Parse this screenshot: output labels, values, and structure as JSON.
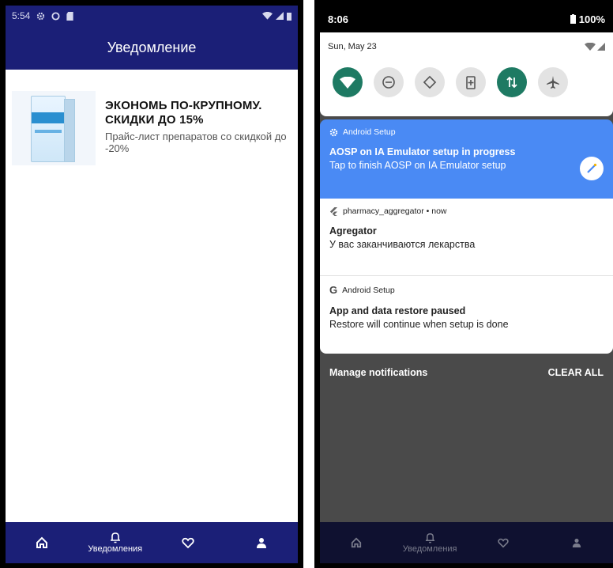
{
  "left": {
    "status": {
      "time": "5:54"
    },
    "appbar": {
      "title": "Уведомление"
    },
    "notification": {
      "title_line1": "ЭКОНОМЬ ПО-КРУПНОМУ.",
      "title_line2": "СКИДКИ ДО 15%",
      "subtitle": "Прайс-лист препаратов со скидкой до -20%",
      "image": "medicine-box-image"
    },
    "nav": {
      "items": [
        {
          "icon": "home-icon",
          "label": ""
        },
        {
          "icon": "bell-icon",
          "label": "Уведомления"
        },
        {
          "icon": "heart-icon",
          "label": ""
        },
        {
          "icon": "person-icon",
          "label": ""
        }
      ]
    }
  },
  "right": {
    "status": {
      "time": "8:06",
      "battery": "100%"
    },
    "quick_settings": {
      "date": "Sun, May 23",
      "tiles": [
        {
          "icon": "wifi-icon",
          "state": "on"
        },
        {
          "icon": "do-not-disturb-icon",
          "state": "off"
        },
        {
          "icon": "auto-rotate-icon",
          "state": "off"
        },
        {
          "icon": "battery-saver-icon",
          "state": "off"
        },
        {
          "icon": "mobile-data-icon",
          "state": "on"
        },
        {
          "icon": "airplane-icon",
          "state": "off"
        }
      ]
    },
    "notifications": [
      {
        "app": "Android Setup",
        "title": "AOSP on IA Emulator setup in progress",
        "text": "Tap to finish AOSP on IA Emulator setup"
      },
      {
        "app": "pharmacy_aggregator • now",
        "title": "Agregator",
        "text": "У вас заканчиваются лекарства"
      },
      {
        "app": "Android Setup",
        "title": "App and data restore paused",
        "text": "Restore will continue when setup is done"
      }
    ],
    "manage_label": "Manage notifications",
    "clear_all_label": "CLEAR ALL",
    "nav": {
      "label": "Уведомления"
    }
  },
  "colors": {
    "brand": "#1b1f77",
    "notification_blue": "#4a8af4",
    "tile_on": "#1e7a63"
  }
}
